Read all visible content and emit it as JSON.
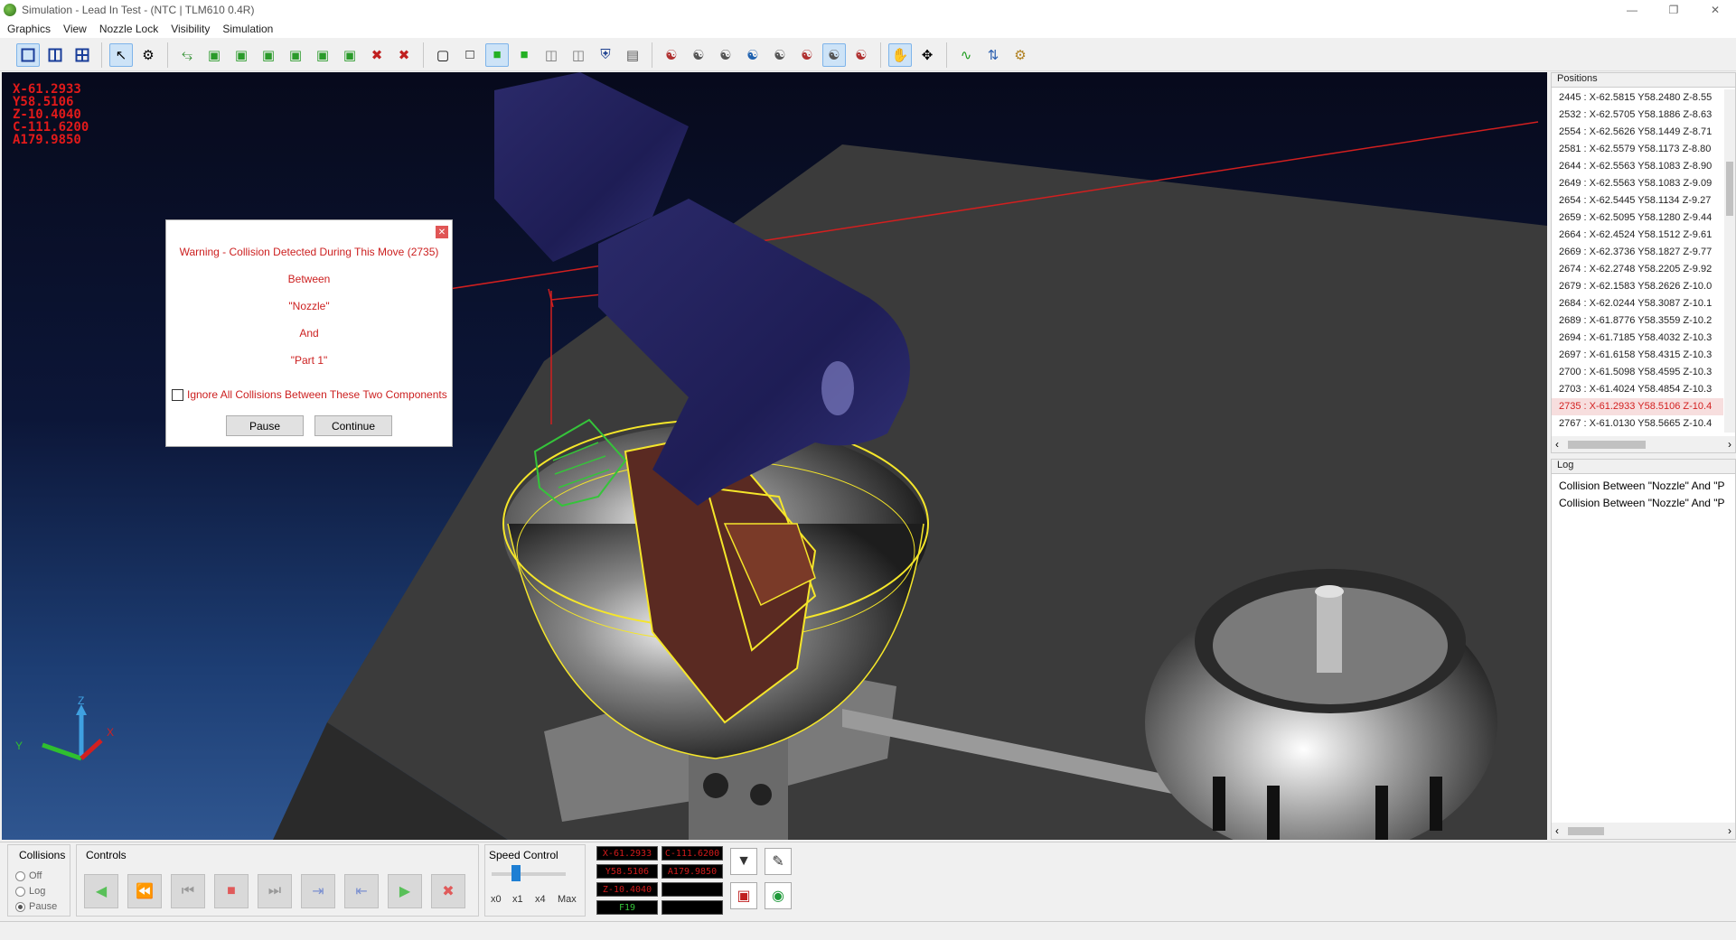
{
  "window": {
    "title": "Simulation - Lead In Test - (NTC | TLM610 0.4R)"
  },
  "menu": [
    "Graphics",
    "View",
    "Nozzle Lock",
    "Visibility",
    "Simulation"
  ],
  "coords": {
    "x": "X-61.2933",
    "y": "Y58.5106",
    "z": "Z-10.4040",
    "c": "C-111.6200",
    "a": "A179.9850"
  },
  "dialog": {
    "line1": "Warning - Collision Detected During This Move (2735)",
    "line2": "Between",
    "line3": "\"Nozzle\"",
    "line4": "And",
    "line5": "\"Part 1\"",
    "checkbox_label": "Ignore All Collisions Between These Two Components",
    "pause_label": "Pause",
    "continue_label": "Continue"
  },
  "positions": {
    "header": "Positions",
    "rows": [
      "2445 :  X-62.5815 Y58.2480 Z-8.55",
      "2532 :  X-62.5705 Y58.1886 Z-8.63",
      "2554 :  X-62.5626 Y58.1449 Z-8.71",
      "2581 :  X-62.5579 Y58.1173 Z-8.80",
      "2644 :  X-62.5563 Y58.1083 Z-8.90",
      "2649 :  X-62.5563 Y58.1083 Z-9.09",
      "2654 :  X-62.5445 Y58.1134 Z-9.27",
      "2659 :  X-62.5095 Y58.1280 Z-9.44",
      "2664 :  X-62.4524 Y58.1512 Z-9.61",
      "2669 :  X-62.3736 Y58.1827 Z-9.77",
      "2674 :  X-62.2748 Y58.2205 Z-9.92",
      "2679 :  X-62.1583 Y58.2626 Z-10.0",
      "2684 :  X-62.0244 Y58.3087 Z-10.1",
      "2689 :  X-61.8776 Y58.3559 Z-10.2",
      "2694 :  X-61.7185 Y58.4032 Z-10.3",
      "2697 :  X-61.6158 Y58.4315 Z-10.3",
      "2700 :  X-61.5098 Y58.4595 Z-10.3",
      "2703 :  X-61.4024 Y58.4854 Z-10.3",
      "2735 :  X-61.2933 Y58.5106 Z-10.4",
      "2767 :  X-61.0130 Y58.5665 Z-10.4"
    ],
    "highlighted_index": 18
  },
  "log": {
    "header": "Log",
    "rows": [
      "Collision Between  \"Nozzle\"  And  \"P",
      "Collision Between  \"Nozzle\"  And  \"P"
    ]
  },
  "bottom": {
    "collisions_title": "Collisions",
    "collisions_options": [
      "Off",
      "Log",
      "Pause"
    ],
    "collisions_selected": "Pause",
    "controls_title": "Controls",
    "speed_title": "Speed Control",
    "speed_labels": [
      "x0",
      "x1",
      "x4",
      "Max"
    ],
    "speed_position": 0.33,
    "readouts": {
      "x": "X-61.2933",
      "c": "C-111.6200",
      "y": "Y58.5106",
      "a": "A179.9850",
      "z": "Z-10.4040",
      "blank1": "",
      "f": "F19",
      "blank2": ""
    }
  },
  "colors": {
    "warning_red": "#cc1f1f",
    "wire_yellow": "#f5e62a",
    "nozzle_blue": "#2a2a70",
    "select_green": "#35c43a"
  }
}
